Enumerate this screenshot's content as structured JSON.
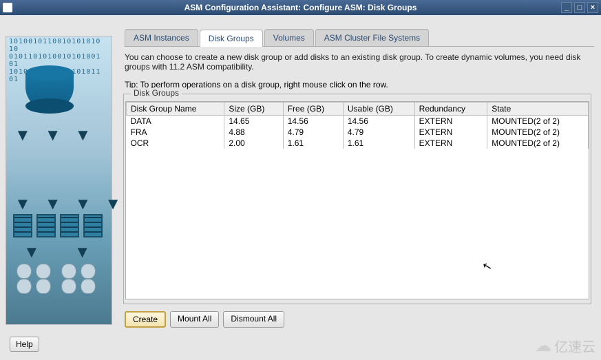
{
  "window": {
    "title": "ASM Configuration Assistant: Configure ASM: Disk Groups",
    "controls": {
      "min": "_",
      "max": "□",
      "close": "×"
    }
  },
  "tabs": [
    {
      "label": "ASM Instances",
      "active": false
    },
    {
      "label": "Disk Groups",
      "active": true
    },
    {
      "label": "Volumes",
      "active": false
    },
    {
      "label": "ASM Cluster File Systems",
      "active": false
    }
  ],
  "description": "You can choose to create a new disk group or add disks to an existing disk group. To create dynamic volumes, you need disk groups with 11.2 ASM compatibility.",
  "tip": "Tip: To perform operations on a disk group, right mouse click on the row.",
  "groupbox_label": "Disk Groups",
  "table": {
    "headers": [
      "Disk Group Name",
      "Size (GB)",
      "Free (GB)",
      "Usable (GB)",
      "Redundancy",
      "State"
    ],
    "rows": [
      [
        "DATA",
        "14.65",
        "14.56",
        "14.56",
        "EXTERN",
        "MOUNTED(2 of 2)"
      ],
      [
        "FRA",
        "4.88",
        "4.79",
        "4.79",
        "EXTERN",
        "MOUNTED(2 of 2)"
      ],
      [
        "OCR",
        "2.00",
        "1.61",
        "1.61",
        "EXTERN",
        "MOUNTED(2 of 2)"
      ]
    ]
  },
  "buttons": {
    "create": "Create",
    "mount_all": "Mount All",
    "dismount_all": "Dismount All",
    "help": "Help"
  },
  "watermark": "亿速云"
}
